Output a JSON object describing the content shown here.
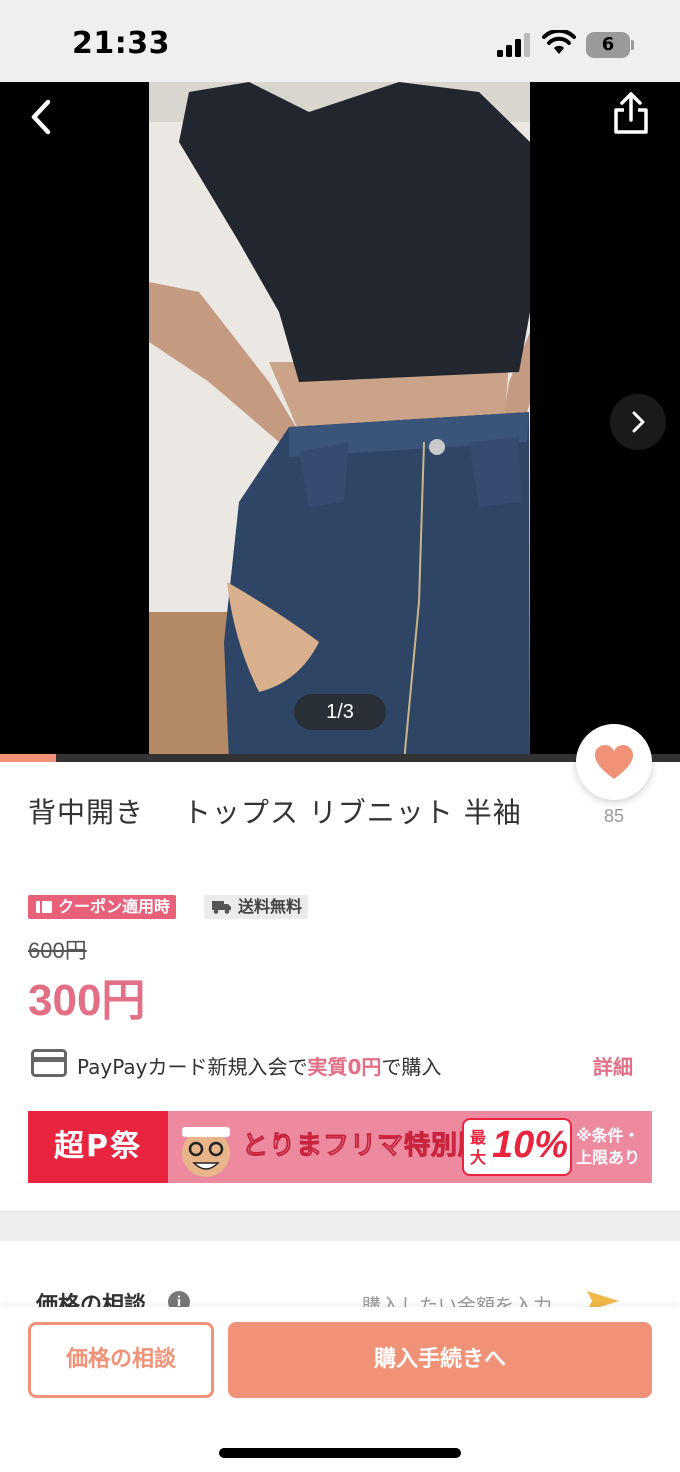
{
  "status_bar": {
    "time": "21:33",
    "battery_level": "6"
  },
  "photo": {
    "counter": "1/3",
    "progress_fraction": 0.082
  },
  "like": {
    "count": "85"
  },
  "product": {
    "title": "背中開き　 トップス リブニット 半袖",
    "coupon_badge": "クーポン適用時",
    "shipping_badge": "送料無料",
    "original_price": "600円",
    "sale_price": "300円"
  },
  "paypay": {
    "text_before": "PayPayカード新規入会で",
    "text_highlight": "実質0円",
    "text_after": "で購入",
    "detail_label": "詳細"
  },
  "banner": {
    "left_text": "超P祭",
    "middle_text": "とりまフリマ特別版",
    "rate_prefix": "最大",
    "rate": "10%",
    "note": "※条件・上限あり"
  },
  "negotiation": {
    "label": "価格の相談",
    "info_icon": "i",
    "placeholder": "購入したい金額を入力"
  },
  "actions": {
    "negotiate_label": "価格の相談",
    "purchase_label": "購入手続きへ"
  },
  "colors": {
    "accent": "#f09277",
    "price": "#e26f85",
    "coupon": "#e8607a",
    "banner_red": "#e8243e"
  }
}
